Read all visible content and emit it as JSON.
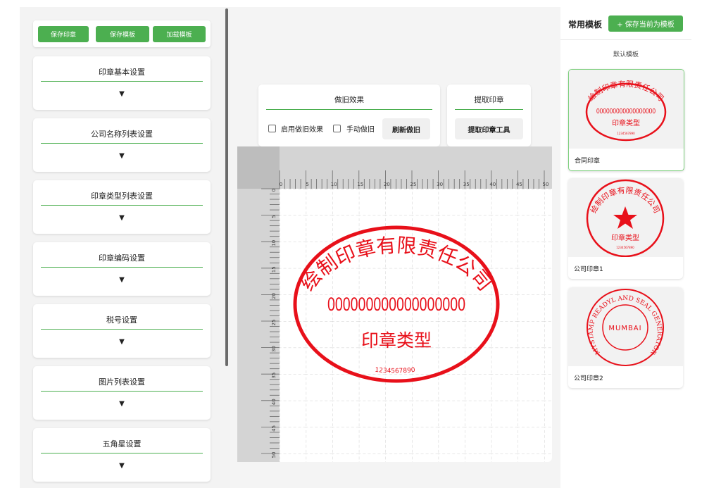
{
  "toolbar": {
    "save_stamp": "保存印章",
    "save_template": "保存模板",
    "load_template": "加载模板"
  },
  "settings": [
    {
      "title": "印章基本设置",
      "arrow": "▼"
    },
    {
      "title": "公司名称列表设置",
      "arrow": "▼"
    },
    {
      "title": "印章类型列表设置",
      "arrow": "▼"
    },
    {
      "title": "印章编码设置",
      "arrow": "▼"
    },
    {
      "title": "税号设置",
      "arrow": "▼"
    },
    {
      "title": "图片列表设置",
      "arrow": "▼"
    },
    {
      "title": "五角星设置",
      "arrow": "▼"
    }
  ],
  "aging": {
    "title": "做旧效果",
    "enable_label": "启用做旧效果",
    "manual_label": "手动做旧",
    "refresh_button": "刷新做旧"
  },
  "extract": {
    "title": "提取印章",
    "tool_button": "提取印章工具"
  },
  "ruler": {
    "top_labels": [
      "0",
      "5",
      "10",
      "15",
      "20",
      "25",
      "30",
      "35",
      "40",
      "45",
      "50"
    ],
    "left_labels": [
      "0",
      "5",
      "10",
      "15",
      "20",
      "25",
      "30",
      "35",
      "40",
      "45",
      "50"
    ]
  },
  "stamp": {
    "company": "绘制印章有限责任公司",
    "code": "000000000000000000",
    "type": "印章类型",
    "serial": "1234567890",
    "color": "#e8101a"
  },
  "templates": {
    "heading": "常用模板",
    "save_button": "+ 保存当前为模板",
    "section": "默认模板",
    "items": [
      {
        "name": "合同印章",
        "company": "绘制印章有限责任公司",
        "code": "000000000000000000",
        "type": "印章类型",
        "serial": "1234567890"
      },
      {
        "name": "公司印章1",
        "company": "绘制印章有限责任公司",
        "type": "印章类型",
        "serial": "1234567890"
      },
      {
        "name": "公司印章2",
        "company": "MYSTAMP READYL AND SEAL GENERATOR",
        "center": "MUMBAI"
      }
    ]
  },
  "colors": {
    "accent": "#4caf50",
    "stamp_red": "#e8101a"
  }
}
